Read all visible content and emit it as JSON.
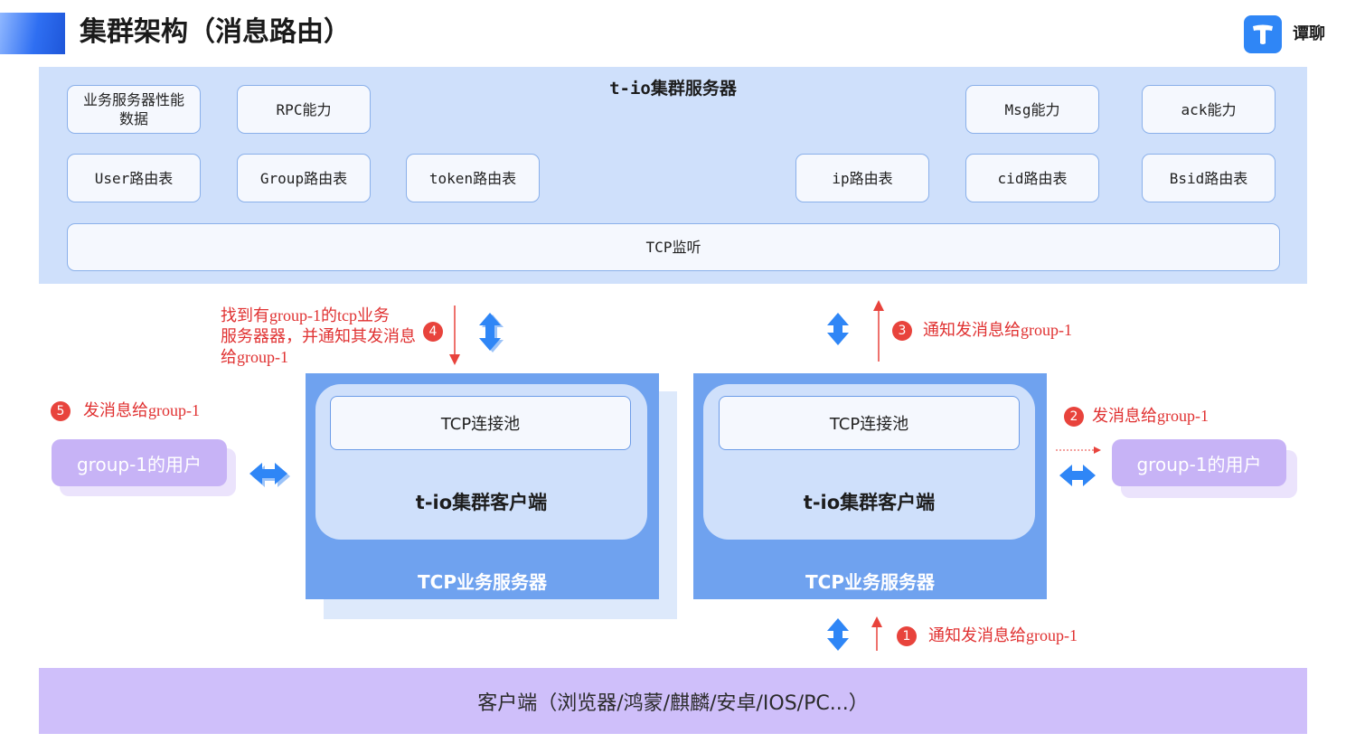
{
  "header": {
    "title": "集群架构（消息路由）",
    "logo_text": "谭聊"
  },
  "cluster": {
    "title": "t-io集群服务器",
    "row1": [
      "业务服务器性能数据",
      "RPC能力",
      "Msg能力",
      "ack能力"
    ],
    "row2": [
      "User路由表",
      "Group路由表",
      "token路由表",
      "ip路由表",
      "cid路由表",
      "Bsid路由表"
    ],
    "listener": "TCP监听"
  },
  "servers": [
    {
      "pool": "TCP连接池",
      "client": "t-io集群客户端",
      "label": "TCP业务服务器"
    },
    {
      "pool": "TCP连接池",
      "client": "t-io集群客户端",
      "label": "TCP业务服务器"
    }
  ],
  "users": [
    "group-1的用户",
    "group-1的用户"
  ],
  "steps": [
    {
      "num": "1",
      "text": "通知发消息给group-1"
    },
    {
      "num": "2",
      "text": "发消息给group-1"
    },
    {
      "num": "3",
      "text": "通知发消息给group-1"
    },
    {
      "num": "4",
      "text_lines": [
        "找到有group-1的tcp业务",
        "服务器器，并通知其发消息",
        "给group-1"
      ]
    },
    {
      "num": "5",
      "text": "发消息给group-1"
    }
  ],
  "clients_bar": "客户端（浏览器/鸿蒙/麒麟/安卓/IOS/PC...）",
  "colors": {
    "accent_blue": "#2f6ff2",
    "panel_blue": "#cfe0fb",
    "server_blue": "#6fa2ef",
    "user_purple": "#c7b3f6",
    "client_purple": "#cfbffa",
    "annotation_red": "#e03131"
  }
}
